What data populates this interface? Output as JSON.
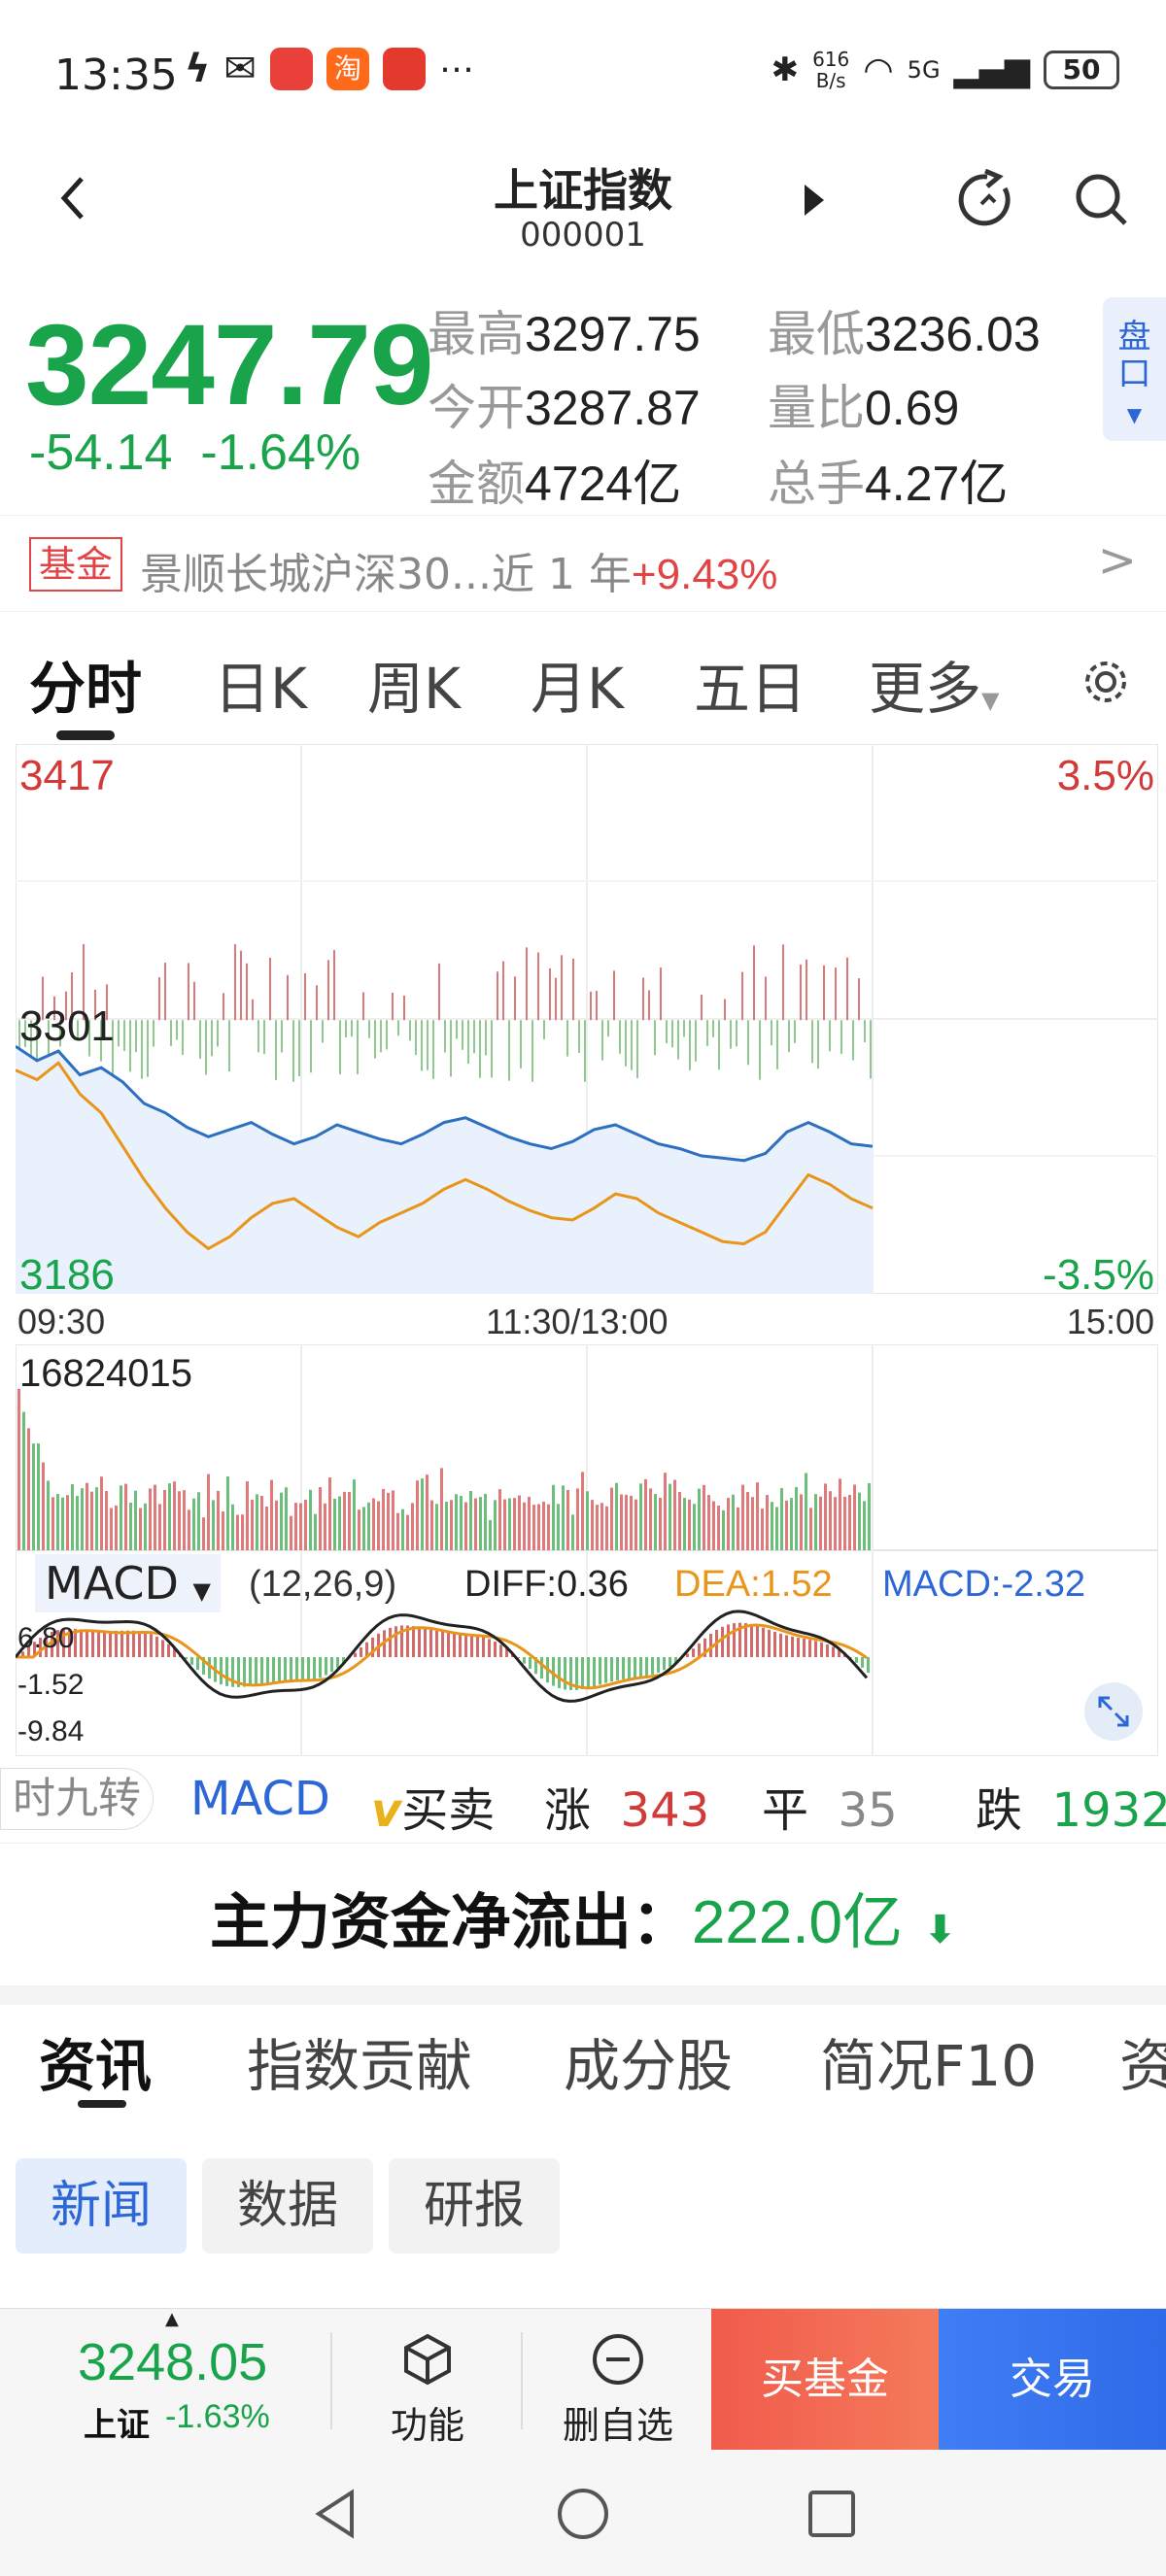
{
  "status_bar": {
    "time": "13:35",
    "net_speed_top": "616",
    "net_speed_unit": "B/s",
    "signal": "5G",
    "battery": "50"
  },
  "header": {
    "title": "上证指数",
    "code": "000001"
  },
  "quote": {
    "price": "3247.79",
    "change": "-54.14",
    "change_pct": "-1.64%",
    "high_label": "最高",
    "high": "3297.75",
    "low_label": "最低",
    "low": "3236.03",
    "open_label": "今开",
    "open": "3287.87",
    "vol_ratio_label": "量比",
    "vol_ratio": "0.69",
    "amount_label": "金额",
    "amount": "4724亿",
    "turnover_label": "总手",
    "turnover": "4.27亿",
    "pankou_label": "盘口"
  },
  "fund_banner": {
    "badge": "基金",
    "text": "景顺长城沪深30...近 1 年",
    "pct": "+9.43%"
  },
  "chart_tabs": [
    "分时",
    "日K",
    "周K",
    "月K",
    "五日",
    "更多"
  ],
  "intraday": {
    "y_max": "3417",
    "y_mid": "3301",
    "y_min": "3186",
    "pct_max": "3.5%",
    "pct_min": "-3.5%",
    "time_start": "09:30",
    "time_mid": "11:30/13:00",
    "time_end": "15:00",
    "volume_max": "16824015"
  },
  "macd": {
    "label": "MACD",
    "params": "(12,26,9)",
    "diff": "DIFF:0.36",
    "dea": "DEA:1.52",
    "macd": "MACD:-2.32",
    "y_top": "6.80",
    "y_mid": "-1.52",
    "y_bottom": "-9.84"
  },
  "indicator_bar": {
    "pill": "时九转",
    "macd_tab": "MACD",
    "buysell": "买卖",
    "up_label": "涨",
    "up": "343",
    "flat_label": "平",
    "flat": "35",
    "down_label": "跌",
    "down": "1932"
  },
  "capital_flow": {
    "label": "主力资金净流出：",
    "amount": "222.0亿"
  },
  "news_tabs": [
    "资讯",
    "指数贡献",
    "成分股",
    "简况F10",
    "资"
  ],
  "news_chips": [
    "新闻",
    "数据",
    "研报"
  ],
  "bottom_bar": {
    "price": "3248.05",
    "name": "上证",
    "pct": "-1.63%",
    "func_label": "功能",
    "remove_label": "删自选",
    "buy_fund": "买基金",
    "trade": "交易"
  },
  "colors": {
    "up": "#d23a3a",
    "down": "#19a34a",
    "accent": "#2d66d6",
    "price_line": "#2d6fc0",
    "avg_line": "#e8951a"
  },
  "chart_data": {
    "type": "line",
    "title": "",
    "x_range": [
      "09:30",
      "15:00"
    ],
    "ylim": [
      3186,
      3417
    ],
    "reference": 3301,
    "series": [
      {
        "values": [
          3290,
          3284,
          3288,
          3278,
          3281,
          3275,
          3266,
          3262,
          3256,
          3252,
          3255,
          3258,
          3253,
          3249,
          3252,
          3257,
          3254,
          3251,
          3249,
          3253,
          3258,
          3260,
          3256,
          3252,
          3249,
          3247,
          3250,
          3255,
          3257,
          3253,
          3249,
          3247,
          3244,
          3243,
          3242,
          3245,
          3254,
          3258,
          3254,
          3249,
          3248
        ]
      },
      {
        "values": [
          3280,
          3276,
          3283,
          3270,
          3262,
          3248,
          3234,
          3222,
          3212,
          3205,
          3210,
          3218,
          3224,
          3226,
          3220,
          3214,
          3210,
          3216,
          3220,
          3224,
          3230,
          3234,
          3230,
          3225,
          3221,
          3218,
          3217,
          3222,
          3228,
          3226,
          3220,
          3216,
          3212,
          3208,
          3207,
          3212,
          3224,
          3236,
          3232,
          3226,
          3222
        ]
      }
    ]
  }
}
